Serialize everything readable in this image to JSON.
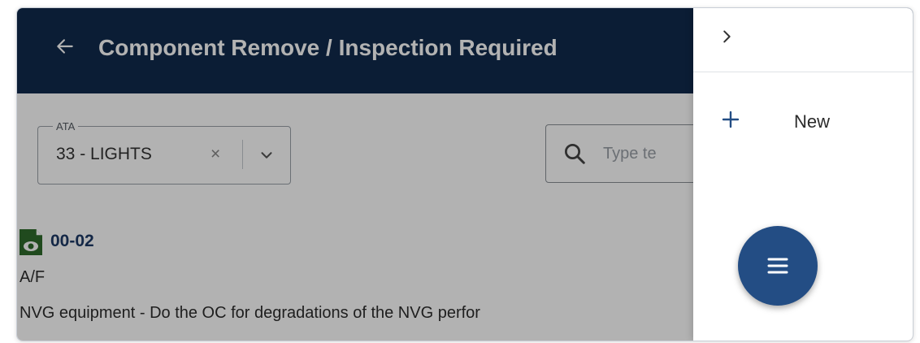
{
  "header": {
    "title": "Component Remove / Inspection Required",
    "back_icon": "arrow-left-icon"
  },
  "filters": {
    "ata": {
      "legend": "ATA",
      "value": "33 - LIGHTS",
      "clear_symbol": "×"
    },
    "search": {
      "placeholder": "Type te"
    }
  },
  "items": [
    {
      "code": "00-02",
      "type": "A/F",
      "description": "NVG equipment - Do the OC for degradations of the NVG perfor",
      "icon": "document-eye-icon"
    }
  ],
  "drawer": {
    "collapse_icon": "chevron-right-icon",
    "menu": [
      {
        "label": "New",
        "icon": "plus-icon"
      }
    ]
  },
  "fab": {
    "icon": "menu-icon"
  },
  "colors": {
    "appbar": "#102a4c",
    "fab": "#234d84",
    "item_code": "#1e3a66",
    "item_icon": "#2e6b2b"
  }
}
